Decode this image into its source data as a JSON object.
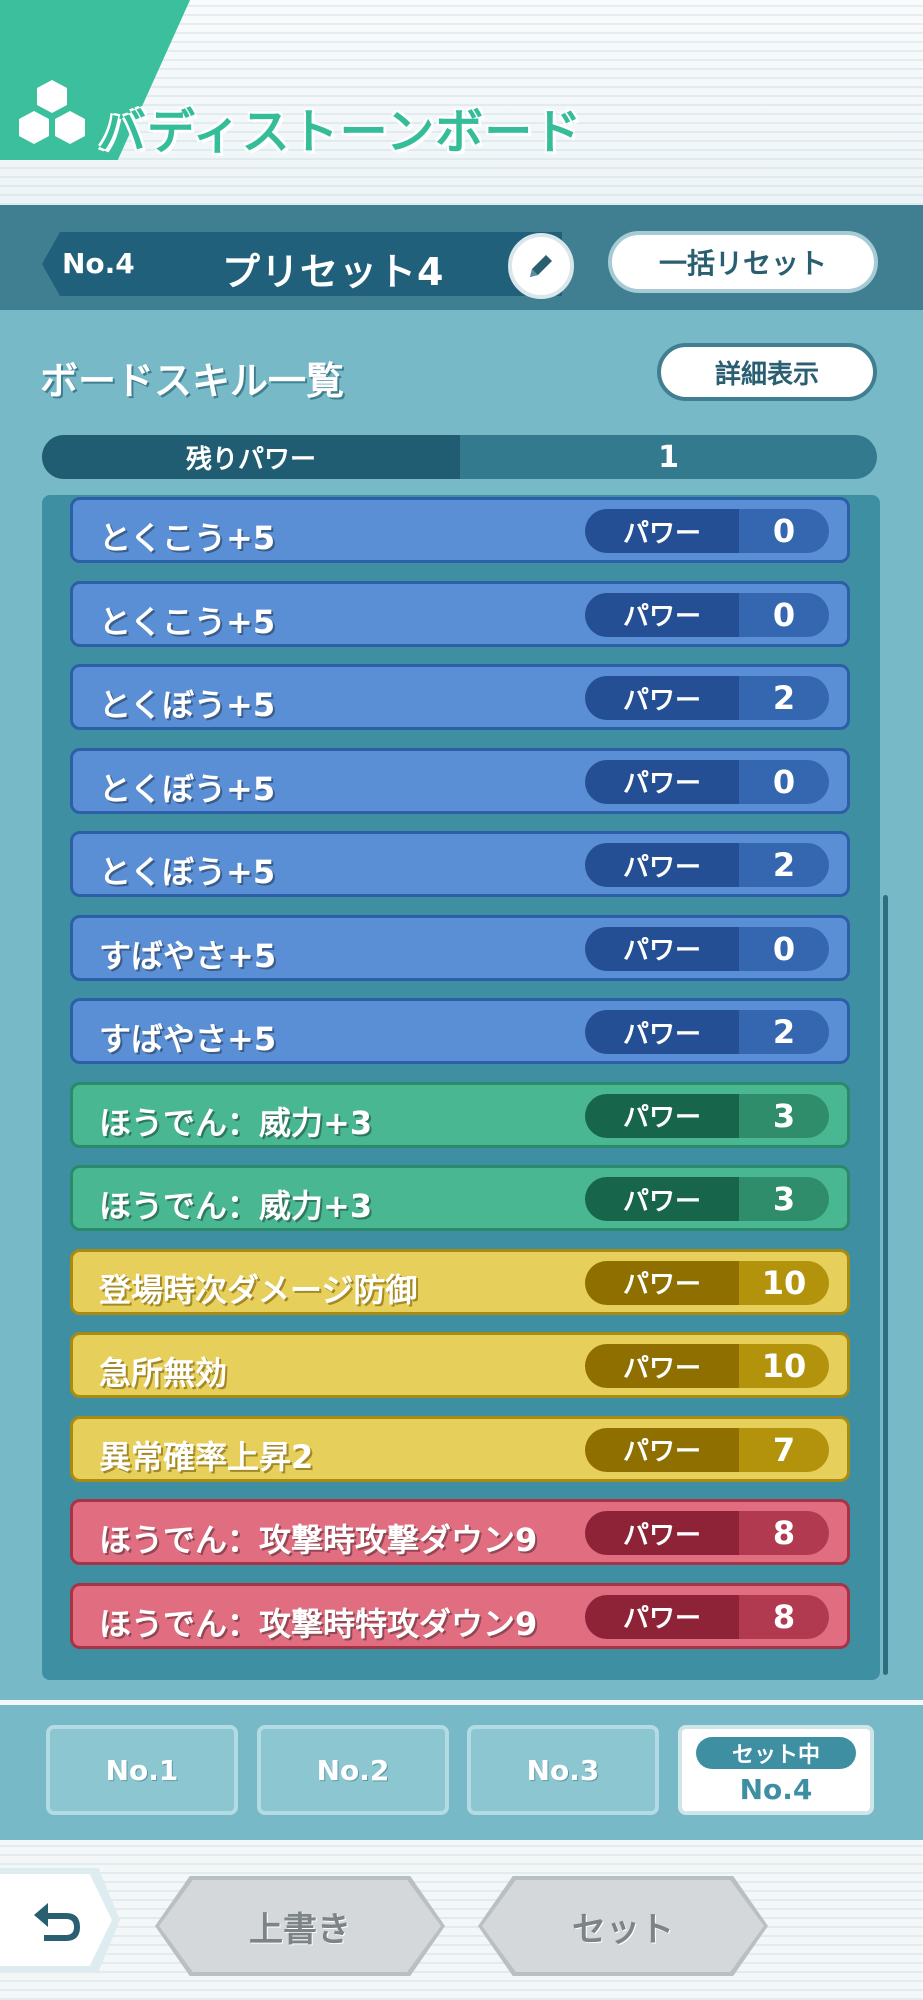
{
  "header": {
    "title": "バディストーンボード"
  },
  "preset": {
    "number": "No.4",
    "name": "プリセット4",
    "reset_label": "一括リセット"
  },
  "skills_section": {
    "title": "ボードスキル一覧",
    "detail_label": "詳細表示"
  },
  "remaining_power": {
    "label": "残りパワー",
    "value": "1"
  },
  "skills": [
    {
      "name": "とくこう+5",
      "power_label": "パワー",
      "power": "0",
      "color": "blue"
    },
    {
      "name": "とくこう+5",
      "power_label": "パワー",
      "power": "0",
      "color": "blue"
    },
    {
      "name": "とくぼう+5",
      "power_label": "パワー",
      "power": "2",
      "color": "blue"
    },
    {
      "name": "とくぼう+5",
      "power_label": "パワー",
      "power": "0",
      "color": "blue"
    },
    {
      "name": "とくぼう+5",
      "power_label": "パワー",
      "power": "2",
      "color": "blue"
    },
    {
      "name": "すばやさ+5",
      "power_label": "パワー",
      "power": "0",
      "color": "blue"
    },
    {
      "name": "すばやさ+5",
      "power_label": "パワー",
      "power": "2",
      "color": "blue"
    },
    {
      "name": "ほうでん：威力+3",
      "power_label": "パワー",
      "power": "3",
      "color": "green"
    },
    {
      "name": "ほうでん：威力+3",
      "power_label": "パワー",
      "power": "3",
      "color": "green"
    },
    {
      "name": "登場時次ダメージ防御",
      "power_label": "パワー",
      "power": "10",
      "color": "yellow"
    },
    {
      "name": "急所無効",
      "power_label": "パワー",
      "power": "10",
      "color": "yellow"
    },
    {
      "name": "異常確率上昇2",
      "power_label": "パワー",
      "power": "7",
      "color": "yellow"
    },
    {
      "name": "ほうでん：攻撃時攻撃ダウン9",
      "power_label": "パワー",
      "power": "8",
      "color": "red"
    },
    {
      "name": "ほうでん：攻撃時特攻ダウン9",
      "power_label": "パワー",
      "power": "8",
      "color": "red"
    }
  ],
  "preset_tabs": {
    "tab1": "No.1",
    "tab2": "No.2",
    "tab3": "No.3",
    "active_badge": "セット中",
    "active": "No.4"
  },
  "bottom": {
    "overwrite_label": "上書き",
    "set_label": "セット"
  },
  "colors": {
    "accent": "#3cbf9c",
    "frame": "#77b9c6",
    "blue_row": "#5a8fd6",
    "green_row": "#49b892",
    "yellow_row": "#e7cf5b",
    "red_row": "#e06e80"
  }
}
